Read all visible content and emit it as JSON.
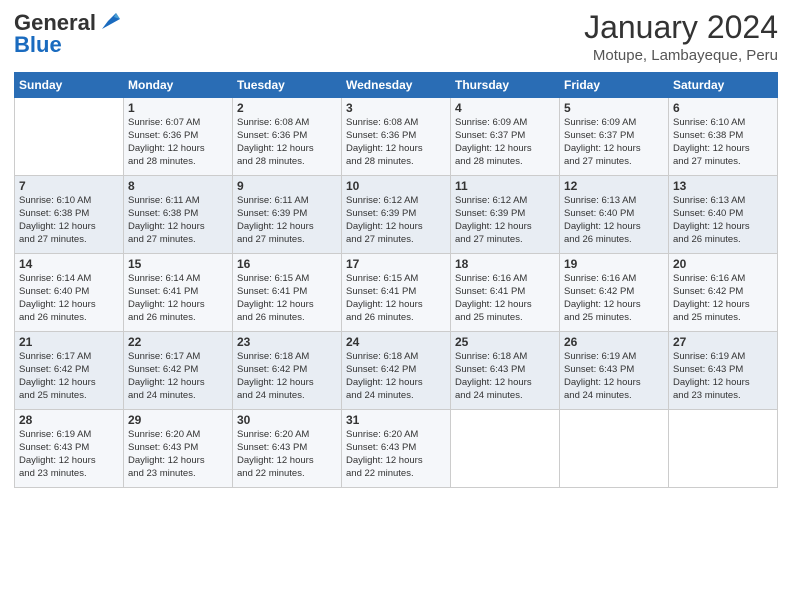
{
  "header": {
    "logo_general": "General",
    "logo_blue": "Blue",
    "month_year": "January 2024",
    "location": "Motupe, Lambayeque, Peru"
  },
  "days_of_week": [
    "Sunday",
    "Monday",
    "Tuesday",
    "Wednesday",
    "Thursday",
    "Friday",
    "Saturday"
  ],
  "weeks": [
    [
      {
        "day": "",
        "info": ""
      },
      {
        "day": "1",
        "info": "Sunrise: 6:07 AM\nSunset: 6:36 PM\nDaylight: 12 hours\nand 28 minutes."
      },
      {
        "day": "2",
        "info": "Sunrise: 6:08 AM\nSunset: 6:36 PM\nDaylight: 12 hours\nand 28 minutes."
      },
      {
        "day": "3",
        "info": "Sunrise: 6:08 AM\nSunset: 6:36 PM\nDaylight: 12 hours\nand 28 minutes."
      },
      {
        "day": "4",
        "info": "Sunrise: 6:09 AM\nSunset: 6:37 PM\nDaylight: 12 hours\nand 28 minutes."
      },
      {
        "day": "5",
        "info": "Sunrise: 6:09 AM\nSunset: 6:37 PM\nDaylight: 12 hours\nand 27 minutes."
      },
      {
        "day": "6",
        "info": "Sunrise: 6:10 AM\nSunset: 6:38 PM\nDaylight: 12 hours\nand 27 minutes."
      }
    ],
    [
      {
        "day": "7",
        "info": "Sunrise: 6:10 AM\nSunset: 6:38 PM\nDaylight: 12 hours\nand 27 minutes."
      },
      {
        "day": "8",
        "info": "Sunrise: 6:11 AM\nSunset: 6:38 PM\nDaylight: 12 hours\nand 27 minutes."
      },
      {
        "day": "9",
        "info": "Sunrise: 6:11 AM\nSunset: 6:39 PM\nDaylight: 12 hours\nand 27 minutes."
      },
      {
        "day": "10",
        "info": "Sunrise: 6:12 AM\nSunset: 6:39 PM\nDaylight: 12 hours\nand 27 minutes."
      },
      {
        "day": "11",
        "info": "Sunrise: 6:12 AM\nSunset: 6:39 PM\nDaylight: 12 hours\nand 27 minutes."
      },
      {
        "day": "12",
        "info": "Sunrise: 6:13 AM\nSunset: 6:40 PM\nDaylight: 12 hours\nand 26 minutes."
      },
      {
        "day": "13",
        "info": "Sunrise: 6:13 AM\nSunset: 6:40 PM\nDaylight: 12 hours\nand 26 minutes."
      }
    ],
    [
      {
        "day": "14",
        "info": "Sunrise: 6:14 AM\nSunset: 6:40 PM\nDaylight: 12 hours\nand 26 minutes."
      },
      {
        "day": "15",
        "info": "Sunrise: 6:14 AM\nSunset: 6:41 PM\nDaylight: 12 hours\nand 26 minutes."
      },
      {
        "day": "16",
        "info": "Sunrise: 6:15 AM\nSunset: 6:41 PM\nDaylight: 12 hours\nand 26 minutes."
      },
      {
        "day": "17",
        "info": "Sunrise: 6:15 AM\nSunset: 6:41 PM\nDaylight: 12 hours\nand 26 minutes."
      },
      {
        "day": "18",
        "info": "Sunrise: 6:16 AM\nSunset: 6:41 PM\nDaylight: 12 hours\nand 25 minutes."
      },
      {
        "day": "19",
        "info": "Sunrise: 6:16 AM\nSunset: 6:42 PM\nDaylight: 12 hours\nand 25 minutes."
      },
      {
        "day": "20",
        "info": "Sunrise: 6:16 AM\nSunset: 6:42 PM\nDaylight: 12 hours\nand 25 minutes."
      }
    ],
    [
      {
        "day": "21",
        "info": "Sunrise: 6:17 AM\nSunset: 6:42 PM\nDaylight: 12 hours\nand 25 minutes."
      },
      {
        "day": "22",
        "info": "Sunrise: 6:17 AM\nSunset: 6:42 PM\nDaylight: 12 hours\nand 24 minutes."
      },
      {
        "day": "23",
        "info": "Sunrise: 6:18 AM\nSunset: 6:42 PM\nDaylight: 12 hours\nand 24 minutes."
      },
      {
        "day": "24",
        "info": "Sunrise: 6:18 AM\nSunset: 6:42 PM\nDaylight: 12 hours\nand 24 minutes."
      },
      {
        "day": "25",
        "info": "Sunrise: 6:18 AM\nSunset: 6:43 PM\nDaylight: 12 hours\nand 24 minutes."
      },
      {
        "day": "26",
        "info": "Sunrise: 6:19 AM\nSunset: 6:43 PM\nDaylight: 12 hours\nand 24 minutes."
      },
      {
        "day": "27",
        "info": "Sunrise: 6:19 AM\nSunset: 6:43 PM\nDaylight: 12 hours\nand 23 minutes."
      }
    ],
    [
      {
        "day": "28",
        "info": "Sunrise: 6:19 AM\nSunset: 6:43 PM\nDaylight: 12 hours\nand 23 minutes."
      },
      {
        "day": "29",
        "info": "Sunrise: 6:20 AM\nSunset: 6:43 PM\nDaylight: 12 hours\nand 23 minutes."
      },
      {
        "day": "30",
        "info": "Sunrise: 6:20 AM\nSunset: 6:43 PM\nDaylight: 12 hours\nand 22 minutes."
      },
      {
        "day": "31",
        "info": "Sunrise: 6:20 AM\nSunset: 6:43 PM\nDaylight: 12 hours\nand 22 minutes."
      },
      {
        "day": "",
        "info": ""
      },
      {
        "day": "",
        "info": ""
      },
      {
        "day": "",
        "info": ""
      }
    ]
  ]
}
